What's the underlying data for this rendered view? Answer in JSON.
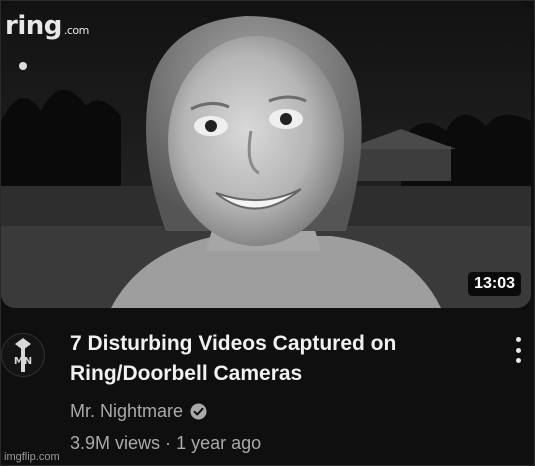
{
  "thumbnail": {
    "logo_text": "ring",
    "logo_suffix": ".com",
    "duration": "13:03"
  },
  "video": {
    "title_line1": "7 Disturbing Videos Captured on",
    "title_line2": "Ring/Doorbell Cameras",
    "channel": "Mr. Nightmare",
    "views": "3.9M views",
    "separator": "·",
    "age": "1 year ago"
  },
  "icons": {
    "verified": "verified-check-icon",
    "menu": "more-vert-icon"
  },
  "watermark": "imgflip.com",
  "colors": {
    "background": "#0f0f0f",
    "title": "#f1f1f1",
    "secondary_text": "#aaaaaa"
  }
}
